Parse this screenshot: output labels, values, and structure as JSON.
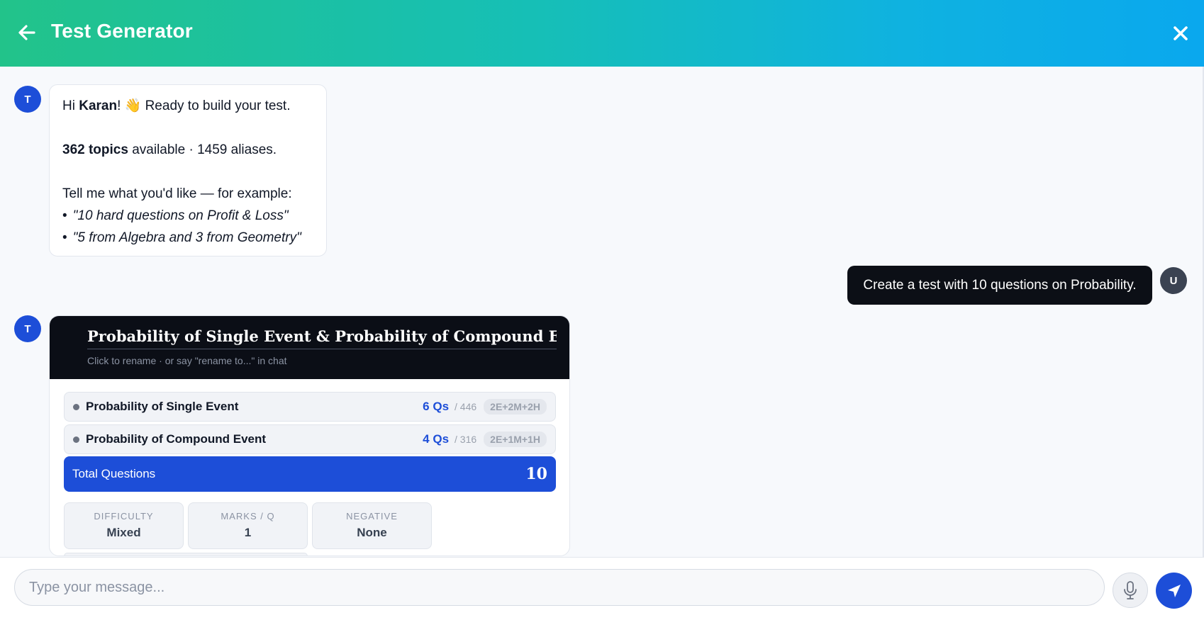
{
  "header": {
    "title": "Test Generator",
    "back_icon": "arrow-left-icon",
    "close_icon": "close-icon"
  },
  "bot_avatar": "T",
  "user_avatar": "U",
  "welcome": {
    "greeting_prefix": "Hi ",
    "user_name": "Karan",
    "greeting_suffix": "! 👋 Ready to build your test.",
    "topics_count": "362 topics",
    "topics_suffix": " available · 1459 aliases.",
    "prompt": "Tell me what you'd like — for example:",
    "examples": [
      "\"10 hard questions on Profit & Loss\"",
      "\"5 from Algebra and 3 from Geometry\""
    ]
  },
  "user_message": "Create a test with 10 questions on Probability.",
  "test_card": {
    "title": "Probability of Single Event & Probability of Compound Event Test",
    "hint": "Click to rename · or say \"rename to...\" in chat",
    "topics": [
      {
        "name": "Probability of Single Event",
        "qs": "6 Qs",
        "available": "/ 446",
        "mix": "2E+2M+2H"
      },
      {
        "name": "Probability of Compound Event",
        "qs": "4 Qs",
        "available": "/ 316",
        "mix": "2E+1M+1H"
      }
    ],
    "total_label": "Total Questions",
    "total_value": "10",
    "stats": [
      {
        "label": "DIFFICULTY",
        "value": "Mixed"
      },
      {
        "label": "MARKS / Q",
        "value": "1"
      },
      {
        "label": "NEGATIVE",
        "value": "None"
      }
    ]
  },
  "composer": {
    "placeholder": "Type your message...",
    "mic_icon": "microphone-icon",
    "send_icon": "send-icon"
  },
  "colors": {
    "accent": "#1d4ed8",
    "header_gradient_start": "#22c38a",
    "header_gradient_end": "#0aa8ee",
    "dark": "#0b0e16"
  }
}
